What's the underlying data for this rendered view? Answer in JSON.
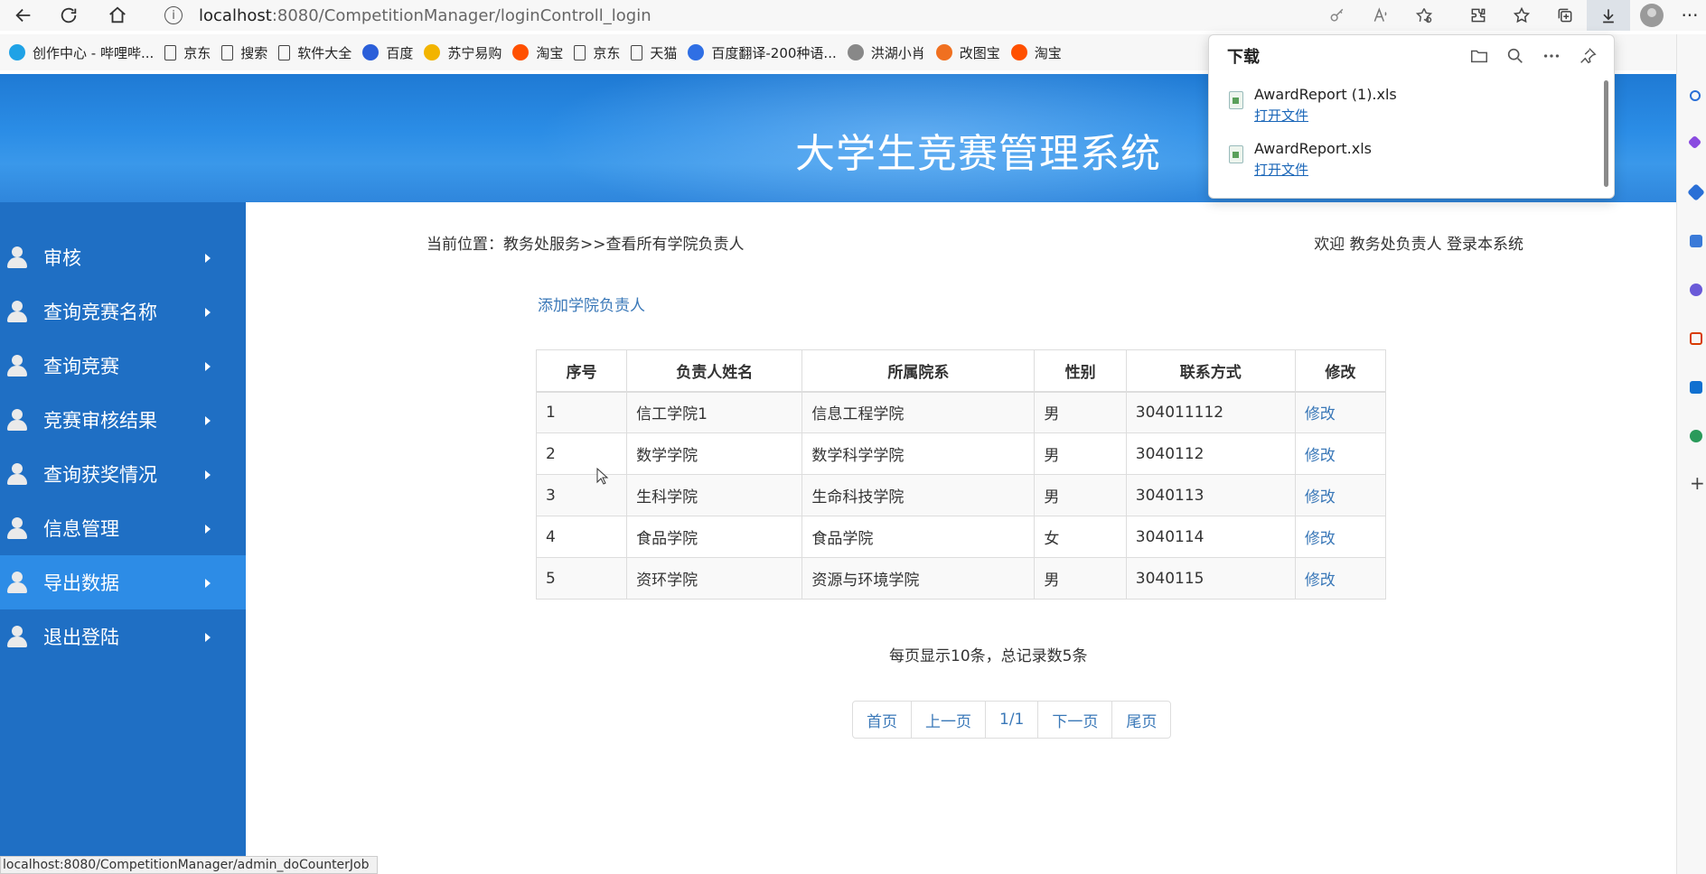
{
  "browser": {
    "url_host": "localhost",
    "url_path": ":8080/CompetitionManager/loginControll_login",
    "bookmarks": [
      {
        "label": "创作中心 - 哔哩哔...",
        "icon": "bilibili-icon",
        "color": "#1fa2e6"
      },
      {
        "label": "京东",
        "icon": "document-icon"
      },
      {
        "label": "搜索",
        "icon": "document-icon"
      },
      {
        "label": "软件大全",
        "icon": "document-icon"
      },
      {
        "label": "百度",
        "icon": "baidu-paw-icon",
        "color": "#2b5fd9"
      },
      {
        "label": "苏宁易购",
        "icon": "suning-icon",
        "color": "#f2b400"
      },
      {
        "label": "淘宝",
        "icon": "taobao-icon",
        "color": "#ff5000"
      },
      {
        "label": "京东",
        "icon": "document-icon"
      },
      {
        "label": "天猫",
        "icon": "document-icon"
      },
      {
        "label": "百度翻译-200种语...",
        "icon": "translate-icon",
        "color": "#2f6fe4"
      },
      {
        "label": "洪湖小肖",
        "icon": "bird-icon"
      },
      {
        "label": "改图宝",
        "icon": "gaitubao-icon",
        "color": "#f07020"
      },
      {
        "label": "淘宝",
        "icon": "taobao-icon",
        "color": "#ff5000"
      }
    ],
    "status_url": "localhost:8080/CompetitionManager/admin_doCounterJob"
  },
  "download_panel": {
    "title": "下载",
    "items": [
      {
        "name": "AwardReport (1).xls",
        "action": "打开文件"
      },
      {
        "name": "AwardReport.xls",
        "action": "打开文件"
      }
    ]
  },
  "banner": {
    "title": "大学生竞赛管理系统"
  },
  "sidebar": {
    "items": [
      {
        "label": "审核"
      },
      {
        "label": "查询竞赛名称"
      },
      {
        "label": "查询竞赛"
      },
      {
        "label": "竞赛审核结果"
      },
      {
        "label": "查询获奖情况"
      },
      {
        "label": "信息管理"
      },
      {
        "label": "导出数据",
        "active": true
      },
      {
        "label": "退出登陆"
      }
    ]
  },
  "main": {
    "breadcrumb": "当前位置：教务处服务>>查看所有学院负责人",
    "welcome": "欢迎 教务处负责人 登录本系统",
    "add_link": "添加学院负责人",
    "table": {
      "headers": [
        "序号",
        "负责人姓名",
        "所属院系",
        "性别",
        "联系方式",
        "修改"
      ],
      "rows": [
        [
          "1",
          "信工学院1",
          "信息工程学院",
          "男",
          "304011112",
          "修改"
        ],
        [
          "2",
          "数学学院",
          "数学科学学院",
          "男",
          "3040112",
          "修改"
        ],
        [
          "3",
          "生科学院",
          "生命科技学院",
          "男",
          "3040113",
          "修改"
        ],
        [
          "4",
          "食品学院",
          "食品学院",
          "女",
          "3040114",
          "修改"
        ],
        [
          "5",
          "资环学院",
          "资源与环境学院",
          "男",
          "3040115",
          "修改"
        ]
      ]
    },
    "summary": "每页显示10条，总记录数5条",
    "pager": [
      "首页",
      "上一页",
      "1/1",
      "下一页",
      "尾页"
    ]
  }
}
